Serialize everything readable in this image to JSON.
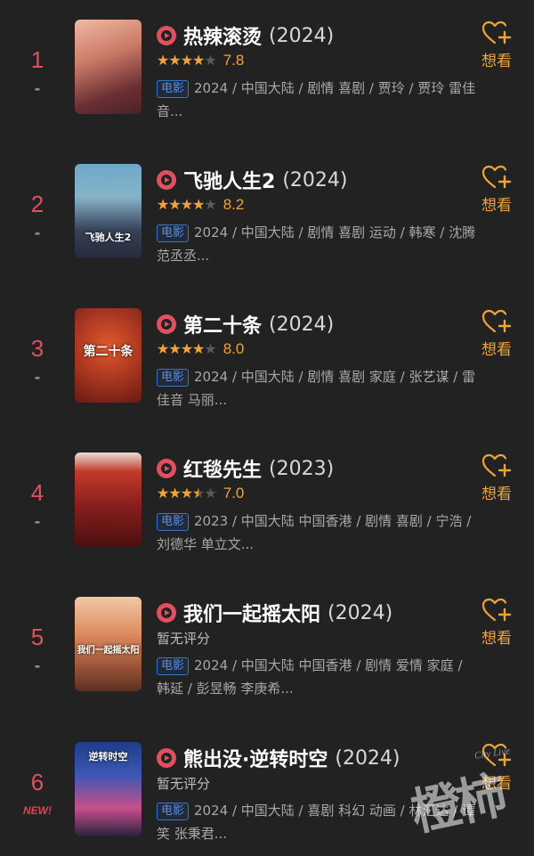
{
  "accent_color": "#e0505f",
  "star_color": "#f1a33a",
  "badge_color": "#3a73c8",
  "items": [
    {
      "rank": "1",
      "trend": "-",
      "poster_text": "",
      "title": "热辣滚烫",
      "year": "(2024)",
      "stars": 0.8,
      "score": "7.8",
      "type": "电影",
      "meta": "2024 / 中国大陆 / 剧情 喜剧 / 贾玲 / 贾玲 雷佳音...",
      "want": "想看",
      "icon": "heart-plus-icon"
    },
    {
      "rank": "2",
      "trend": "-",
      "poster_text": "飞驰人生2",
      "title": "飞驰人生2",
      "year": "(2024)",
      "stars": 0.8,
      "score": "8.2",
      "type": "电影",
      "meta": "2024 / 中国大陆 / 剧情 喜剧 运动 / 韩寒 / 沈腾 范丞丞...",
      "want": "想看",
      "icon": "heart-plus-icon"
    },
    {
      "rank": "3",
      "trend": "-",
      "poster_text": "第二十条",
      "title": "第二十条",
      "year": "(2024)",
      "stars": 0.8,
      "score": "8.0",
      "type": "电影",
      "meta": "2024 / 中国大陆 / 剧情 喜剧 家庭 / 张艺谋 / 雷佳音 马丽...",
      "want": "想看",
      "icon": "heart-plus-icon"
    },
    {
      "rank": "4",
      "trend": "-",
      "poster_text": "",
      "title": "红毯先生",
      "year": "(2023)",
      "stars": 0.7,
      "score": "7.0",
      "type": "电影",
      "meta": "2023 / 中国大陆 中国香港 / 剧情 喜剧 / 宁浩 / 刘德华 单立文...",
      "want": "想看",
      "icon": "heart-plus-icon"
    },
    {
      "rank": "5",
      "trend": "-",
      "poster_text": "我们一起摇太阳",
      "title": "我们一起摇太阳",
      "year": "(2024)",
      "no_score": "暂无评分",
      "type": "电影",
      "meta": "2024 / 中国大陆 中国香港 / 剧情 爱情 家庭 / 韩延 / 彭昱畅 李庚希...",
      "want": "想看",
      "icon": "heart-plus-icon"
    },
    {
      "rank": "6",
      "new": "NEW!",
      "poster_text": "逆转时空",
      "title": "熊出没·逆转时空",
      "year": "(2024)",
      "no_score": "暂无评分",
      "type": "电影",
      "meta": "2024 / 中国大陆 / 喜剧 科幻 动画 / 林汇达 / 谭笑 张秉君...",
      "want": "想看",
      "icon": "heart-plus-icon"
    }
  ],
  "watermark": {
    "main": "橙柿",
    "small": "City Live"
  }
}
